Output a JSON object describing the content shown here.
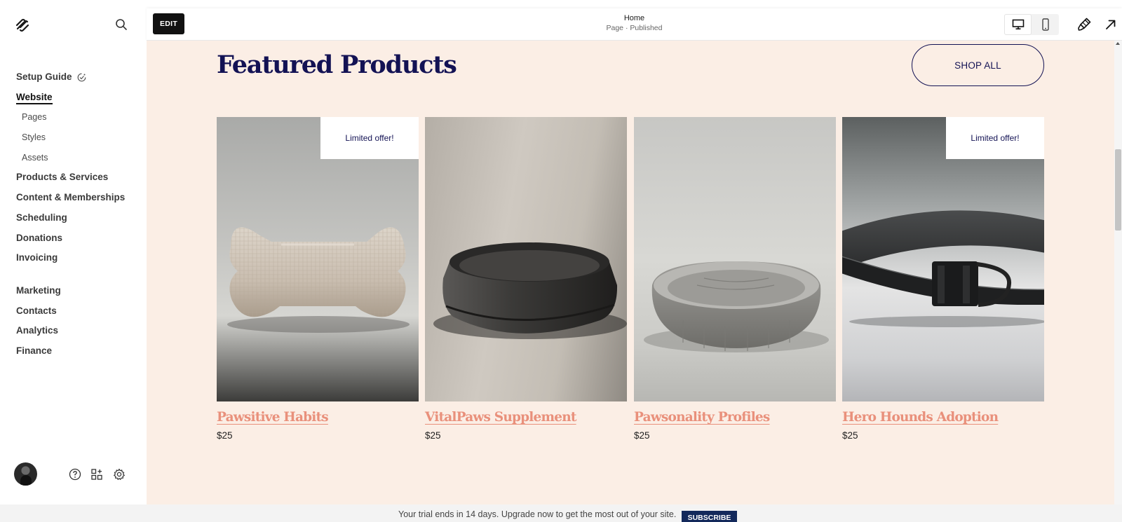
{
  "sidebar": {
    "logo_icon": "squarespace-logo-icon",
    "search_icon": "search-icon",
    "setup_guide": "Setup Guide",
    "website": "Website",
    "website_sub": [
      "Pages",
      "Styles",
      "Assets"
    ],
    "items_group1": [
      "Products & Services",
      "Content & Memberships",
      "Scheduling",
      "Donations",
      "Invoicing"
    ],
    "items_group2": [
      "Marketing",
      "Contacts",
      "Analytics",
      "Finance"
    ],
    "footer_icons": [
      "help-icon",
      "apps-icon",
      "settings-icon"
    ]
  },
  "topbar": {
    "edit_label": "EDIT",
    "page_title": "Home",
    "page_status": "Page · Published",
    "view_modes": [
      "desktop-icon",
      "mobile-icon"
    ],
    "active_view": "desktop",
    "tools": [
      "paintbrush-icon",
      "open-external-icon"
    ]
  },
  "canvas": {
    "background": "#fbeee5",
    "section_title": "Featured Products",
    "shop_all_label": "SHOP ALL",
    "title_color": "#131254",
    "product_name_color": "#e9907b",
    "products": [
      {
        "name": "Pawsitive Habits",
        "price": "$25",
        "badge": "Limited offer!",
        "image": "bone-toy"
      },
      {
        "name": "VitalPaws Supplement",
        "price": "$25",
        "badge": "",
        "image": "dark-bowl"
      },
      {
        "name": "Pawsonality Profiles",
        "price": "$25",
        "badge": "",
        "image": "round-dog-bed"
      },
      {
        "name": "Hero Hounds Adoption",
        "price": "$25",
        "badge": "Limited offer!",
        "image": "dark-collar"
      }
    ]
  },
  "trial_banner": {
    "text": "Your trial ends in 14 days. Upgrade now to get the most out of your site.",
    "button": "SUBSCRIBE",
    "button_color": "#13295b"
  }
}
